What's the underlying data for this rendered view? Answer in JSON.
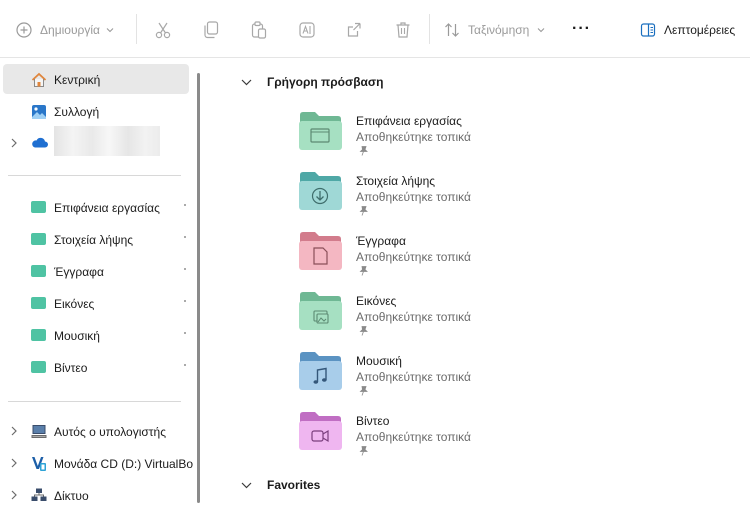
{
  "toolbar": {
    "new_label": "Δημιουργία",
    "sort_label": "Ταξινόμηση",
    "more_label": "···",
    "details_label": "Λεπτομέρειες"
  },
  "sidebar": {
    "home": "Κεντρική",
    "gallery": "Συλλογή",
    "quick": [
      "Επιφάνεια εργασίας",
      "Στοιχεία λήψης",
      "Έγγραφα",
      "Εικόνες",
      "Μουσική",
      "Βίντεο"
    ],
    "this_pc": "Αυτός ο υπολογιστής",
    "cd_drive": "Μονάδα CD (D:) VirtualBo",
    "network": "Δίκτυο"
  },
  "content": {
    "quick_access_header": "Γρήγορη πρόσβαση",
    "favorites_header": "Favorites",
    "items": [
      {
        "name": "Επιφάνεια εργασίας",
        "status": "Αποθηκεύτηκε τοπικά",
        "icon": "desktop-folder-icon"
      },
      {
        "name": "Στοιχεία λήψης",
        "status": "Αποθηκεύτηκε τοπικά",
        "icon": "downloads-folder-icon"
      },
      {
        "name": "Έγγραφα",
        "status": "Αποθηκεύτηκε τοπικά",
        "icon": "documents-folder-icon"
      },
      {
        "name": "Εικόνες",
        "status": "Αποθηκεύτηκε τοπικά",
        "icon": "pictures-folder-icon"
      },
      {
        "name": "Μουσική",
        "status": "Αποθηκεύτηκε τοπικά",
        "icon": "music-folder-icon"
      },
      {
        "name": "Βίντεο",
        "status": "Αποθηκεύτηκε τοπικά",
        "icon": "videos-folder-icon"
      }
    ]
  },
  "colors": {
    "selection": "#e8e8e8",
    "folder_green": "#7fcfa8",
    "folder_teal": "#6cc6c6",
    "folder_pink": "#f0a6b4",
    "folder_blue": "#7fb2d6",
    "folder_purple": "#d796d8"
  }
}
